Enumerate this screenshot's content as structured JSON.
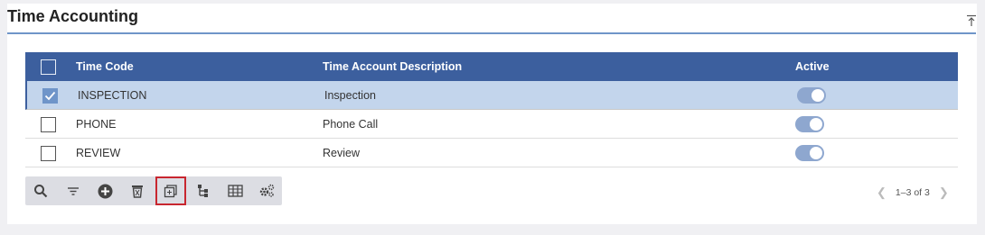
{
  "panel": {
    "title": "Time Accounting",
    "collapse_icon": "collapse-to-top-icon"
  },
  "grid": {
    "columns": [
      "Time Code",
      "Time Account Description",
      "Active"
    ],
    "rows": [
      {
        "code": "INSPECTION",
        "description": "Inspection",
        "active": true,
        "selected": true
      },
      {
        "code": "PHONE",
        "description": "Phone Call",
        "active": true,
        "selected": false
      },
      {
        "code": "REVIEW",
        "description": "Review",
        "active": true,
        "selected": false
      }
    ]
  },
  "toolbar": {
    "buttons": [
      "search-icon",
      "filter-icon",
      "add-icon",
      "delete-icon",
      "copy-icon",
      "tree-icon",
      "columns-icon",
      "settings-icon"
    ],
    "highlighted": "copy-icon"
  },
  "pager": {
    "range": "1–3 of 3"
  },
  "colors": {
    "header": "#3c5f9e",
    "selected_row": "#c3d5ec",
    "toggle": "#8ea7cf",
    "highlight": "#c8262f"
  }
}
